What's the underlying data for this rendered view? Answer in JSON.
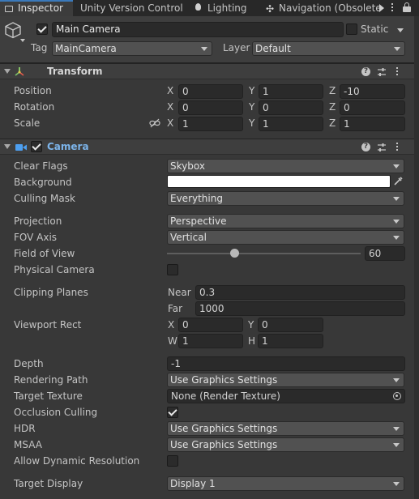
{
  "tabs": [
    {
      "label": "Inspector"
    },
    {
      "label": "Unity Version Control"
    },
    {
      "label": "Lighting"
    },
    {
      "label": "Navigation (Obsolete"
    }
  ],
  "header": {
    "name": "Main Camera",
    "static_label": "Static",
    "tag_label": "Tag",
    "tag_value": "MainCamera",
    "layer_label": "Layer",
    "layer_value": "Default"
  },
  "transform": {
    "title": "Transform",
    "rows": [
      {
        "label": "Position",
        "x": "0",
        "y": "1",
        "z": "-10"
      },
      {
        "label": "Rotation",
        "x": "0",
        "y": "0",
        "z": "0"
      },
      {
        "label": "Scale",
        "x": "1",
        "y": "1",
        "z": "1"
      }
    ],
    "axes": [
      "X",
      "Y",
      "Z"
    ]
  },
  "camera": {
    "title": "Camera",
    "clear_flags": {
      "label": "Clear Flags",
      "value": "Skybox"
    },
    "background": {
      "label": "Background",
      "color": "#ffffff"
    },
    "culling_mask": {
      "label": "Culling Mask",
      "value": "Everything"
    },
    "projection": {
      "label": "Projection",
      "value": "Perspective"
    },
    "fov_axis": {
      "label": "FOV Axis",
      "value": "Vertical"
    },
    "field_of_view": {
      "label": "Field of View",
      "value": "60",
      "slider_fraction": 0.35
    },
    "physical_camera": {
      "label": "Physical Camera",
      "checked": false
    },
    "clipping_planes": {
      "label": "Clipping Planes",
      "near_label": "Near",
      "near": "0.3",
      "far_label": "Far",
      "far": "1000"
    },
    "viewport_rect": {
      "label": "Viewport Rect",
      "x_label": "X",
      "x": "0",
      "y_label": "Y",
      "y": "0",
      "w_label": "W",
      "w": "1",
      "h_label": "H",
      "h": "1"
    },
    "depth": {
      "label": "Depth",
      "value": "-1"
    },
    "rendering_path": {
      "label": "Rendering Path",
      "value": "Use Graphics Settings"
    },
    "target_texture": {
      "label": "Target Texture",
      "value": "None (Render Texture)"
    },
    "occlusion_culling": {
      "label": "Occlusion Culling",
      "checked": true
    },
    "hdr": {
      "label": "HDR",
      "value": "Use Graphics Settings"
    },
    "msaa": {
      "label": "MSAA",
      "value": "Use Graphics Settings"
    },
    "allow_dynamic_resolution": {
      "label": "Allow Dynamic Resolution",
      "checked": false
    },
    "target_display": {
      "label": "Target Display",
      "value": "Display 1"
    }
  },
  "colors": {
    "accent": "#3a79bb",
    "camera_title": "#7cb4ea",
    "panel": "#383838"
  }
}
